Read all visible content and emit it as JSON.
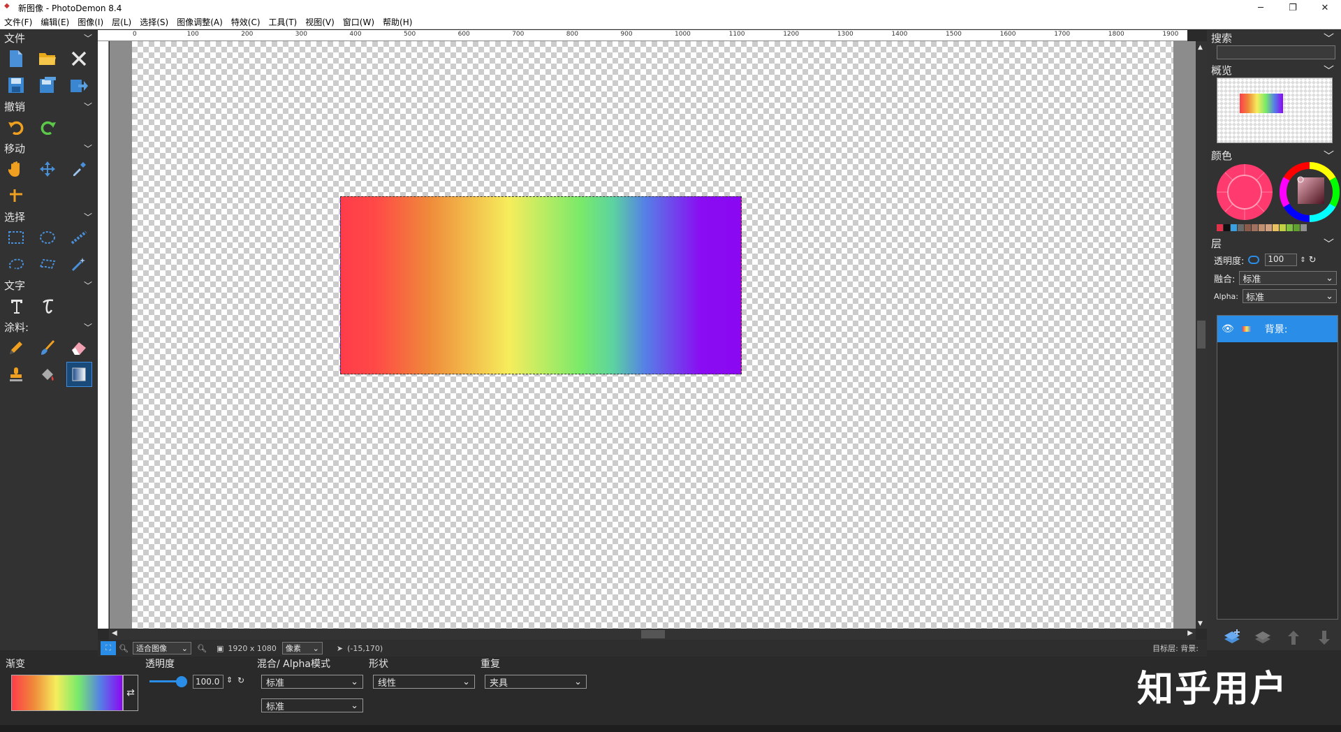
{
  "titlebar": {
    "title": "新图像  -  PhotoDemon 8.4"
  },
  "menu": [
    "文件(F)",
    "编辑(E)",
    "图像(I)",
    "层(L)",
    "选择(S)",
    "图像调整(A)",
    "特效(C)",
    "工具(T)",
    "视图(V)",
    "窗口(W)",
    "帮助(H)"
  ],
  "left_sections": {
    "file": "文件",
    "undo": "撤销",
    "move": "移动",
    "select": "选择",
    "text": "文字",
    "paint": "涂料:"
  },
  "ruler": {
    "top": [
      "0",
      "100",
      "200",
      "300",
      "400",
      "500",
      "600",
      "700",
      "800",
      "900",
      "1000",
      "1100",
      "1200",
      "1300",
      "1400",
      "1500",
      "1600",
      "1700",
      "1800",
      "1900"
    ]
  },
  "status": {
    "zoom": "适合图像",
    "size": "1920 x 1080",
    "unit": "像素",
    "coords": "(-15,170)",
    "target": "目标层:  背景:"
  },
  "right": {
    "search": "搜索",
    "overview": "概览",
    "color": "颜色",
    "layers": "层",
    "opacity_label": "透明度:",
    "opacity_value": "100",
    "blend_label": "融合:",
    "blend_value": "标准",
    "alpha_label": "Alpha:",
    "alpha_value": "标准",
    "layer_name": "背景:",
    "palette_colors": [
      "#e0304a",
      "#111111",
      "#3aa0e0",
      "#6a6a6a",
      "#8a5a4a",
      "#a07060",
      "#c09070",
      "#d0a080",
      "#e8c060",
      "#c0d040",
      "#80c040",
      "#60a030",
      "#909090"
    ]
  },
  "bottom": {
    "gradient_label": "渐变",
    "opacity_label": "透明度",
    "opacity_value": "100.0",
    "blend_label": "混合/ Alpha模式",
    "blend_value": "标准",
    "alpha_value": "标准",
    "shape_label": "形状",
    "shape_value": "线性",
    "repeat_label": "重复",
    "repeat_value": "夹具"
  },
  "watermark": "知乎用户"
}
